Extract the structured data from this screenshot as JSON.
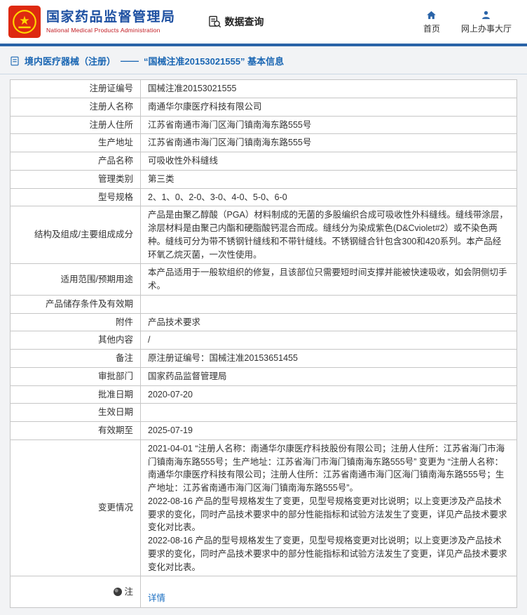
{
  "colors": {
    "accent_blue": "#2a64a8",
    "brand_blue": "#1c4fa1",
    "brand_red": "#c11920",
    "link_blue": "#1b6fc2",
    "emblem_red": "#de2910",
    "emblem_gold": "#ffd700",
    "border_gray": "#c6c6c6"
  },
  "header": {
    "org_name_cn": "国家药品监督管理局",
    "org_name_en": "National Medical Products Administration",
    "data_query_label": "数据查询",
    "nav": [
      {
        "label": "首页"
      },
      {
        "label": "网上办事大厅"
      }
    ]
  },
  "breadcrumb": {
    "category": "境内医疗器械（注册）",
    "dash": "——",
    "title": "“国械注准20153021555” 基本信息"
  },
  "table": {
    "rows": [
      {
        "label": "注册证编号",
        "value": "国械注准20153021555"
      },
      {
        "label": "注册人名称",
        "value": "南通华尔康医疗科技有限公司"
      },
      {
        "label": "注册人住所",
        "value": "江苏省南通市海门区海门镇南海东路555号"
      },
      {
        "label": "生产地址",
        "value": "江苏省南通市海门区海门镇南海东路555号"
      },
      {
        "label": "产品名称",
        "value": "可吸收性外科缝线"
      },
      {
        "label": "管理类别",
        "value": "第三类"
      },
      {
        "label": "型号规格",
        "value": "2、1、0、2-0、3-0、4-0、5-0、6-0"
      },
      {
        "label": "结构及组成/主要组成成分",
        "value": "产品是由聚乙醇酸（PGA）材料制成的无菌的多股编织合成可吸收性外科缝线。缝线带涂层，涂层材料是由聚己内酯和硬脂酸钙混合而成。缝线分为染成紫色(D&Cviolet#2）或不染色两种。缝线可分为带不锈钢针缝线和不带针缝线。不锈钢缝合针包含300和420系列。本产品经环氧乙烷灭菌，一次性使用。"
      },
      {
        "label": "适用范围/预期用途",
        "value": "本产品适用于一般软组织的修复，且该部位只需要短时间支撑并能被快速吸收，如会阴侧切手术。"
      },
      {
        "label": "产品储存条件及有效期",
        "value": ""
      },
      {
        "label": "附件",
        "value": "产品技术要求"
      },
      {
        "label": "其他内容",
        "value": "/"
      },
      {
        "label": "备注",
        "value": "原注册证编号：国械注准20153651455"
      },
      {
        "label": "审批部门",
        "value": "国家药品监督管理局"
      },
      {
        "label": "批准日期",
        "value": "2020-07-20"
      },
      {
        "label": "生效日期",
        "value": ""
      },
      {
        "label": "有效期至",
        "value": "2025-07-19"
      },
      {
        "label": "变更情况",
        "value": "2021-04-01 “注册人名称：南通华尔康医疗科技股份有限公司；注册人住所：江苏省海门市海门镇南海东路555号；生产地址：江苏省海门市海门镇南海东路555号” 变更为 “注册人名称：南通华尔康医疗科技有限公司；注册人住所：江苏省南通市海门区海门镇南海东路555号；生产地址：江苏省南通市海门区海门镇南海东路555号”。\n2022-08-16 产品的型号规格发生了变更，见型号规格变更对比说明；以上变更涉及产品技术要求的变化，同时产品技术要求中的部分性能指标和试验方法发生了变更，详见产品技术要求变化对比表。\n2022-08-16 产品的型号规格发生了变更，见型号规格变更对比说明；以上变更涉及产品技术要求的变化，同时产品技术要求中的部分性能指标和试验方法发生了变更，详见产品技术要求变化对比表。"
      }
    ],
    "note_row": {
      "label": "注",
      "link": "详情"
    }
  }
}
